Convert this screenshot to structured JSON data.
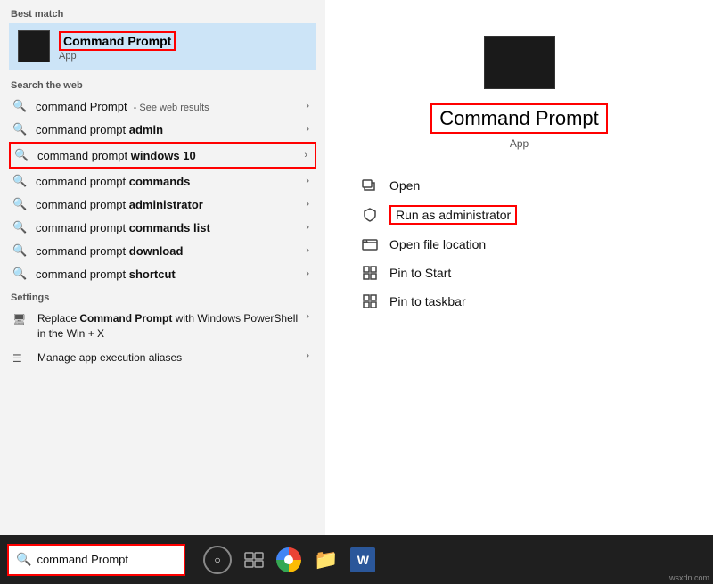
{
  "leftPanel": {
    "bestMatch": {
      "sectionLabel": "Best match",
      "appName": "Command Prompt",
      "appType": "App"
    },
    "searchWeb": {
      "sectionLabel": "Search the web",
      "items": [
        {
          "text": "command Prompt",
          "suffix": " - See web results",
          "bold": false
        },
        {
          "text": "command prompt ",
          "bold_part": "admin",
          "bold": true
        },
        {
          "text": "command prompt ",
          "bold_part": "windows 10",
          "bold": true
        },
        {
          "text": "command prompt ",
          "bold_part": "commands",
          "bold": true
        },
        {
          "text": "command prompt ",
          "bold_part": "administrator",
          "bold": true
        },
        {
          "text": "command prompt ",
          "bold_part": "commands list",
          "bold": true
        },
        {
          "text": "command prompt ",
          "bold_part": "download",
          "bold": true
        },
        {
          "text": "command prompt ",
          "bold_part": "shortcut",
          "bold": true
        }
      ]
    },
    "settings": {
      "sectionLabel": "Settings",
      "items": [
        {
          "text": "Replace Command Prompt with Windows PowerShell in the Win + X"
        },
        {
          "text": "Manage app execution aliases"
        }
      ]
    }
  },
  "rightPanel": {
    "appTitle": "Command Prompt",
    "appType": "App",
    "actions": [
      {
        "id": "open",
        "label": "Open"
      },
      {
        "id": "run-admin",
        "label": "Run as administrator"
      },
      {
        "id": "open-location",
        "label": "Open file location"
      },
      {
        "id": "pin-start",
        "label": "Pin to Start"
      },
      {
        "id": "pin-taskbar",
        "label": "Pin to taskbar"
      }
    ]
  },
  "taskbar": {
    "searchText": "command Prompt",
    "searchPlaceholder": "command Prompt",
    "wsxdn": "wsxdn.com"
  }
}
